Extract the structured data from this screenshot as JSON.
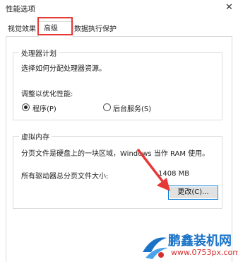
{
  "window": {
    "title": "性能选项",
    "close_glyph": "✕"
  },
  "tabs": [
    {
      "label": "视觉效果",
      "selected": false
    },
    {
      "label": "高级",
      "selected": true
    },
    {
      "label": "数据执行保护",
      "selected": false
    }
  ],
  "processor_group": {
    "title": "处理器计划",
    "description": "选择如何分配处理器资源。",
    "adjust_label": "调整以优化性能:",
    "options": [
      {
        "label": "程序(P)",
        "checked": true
      },
      {
        "label": "后台服务(S)",
        "checked": false
      }
    ]
  },
  "virtual_memory_group": {
    "title": "虚拟内存",
    "description": "分页文件是硬盘上的一块区域，Windows 当作 RAM 使用。",
    "total_label": "所有驱动器总分页文件大小:",
    "total_value": "1408 MB",
    "change_button": "更改(C)..."
  },
  "colors": {
    "highlight_red": "#e53935",
    "focus_blue": "#0078d7",
    "watermark_blue": "#1a73c7",
    "watermark_red": "#d32f2f"
  },
  "watermark": {
    "name": "鹏鑫装机网",
    "url": "www.0753px.com"
  }
}
